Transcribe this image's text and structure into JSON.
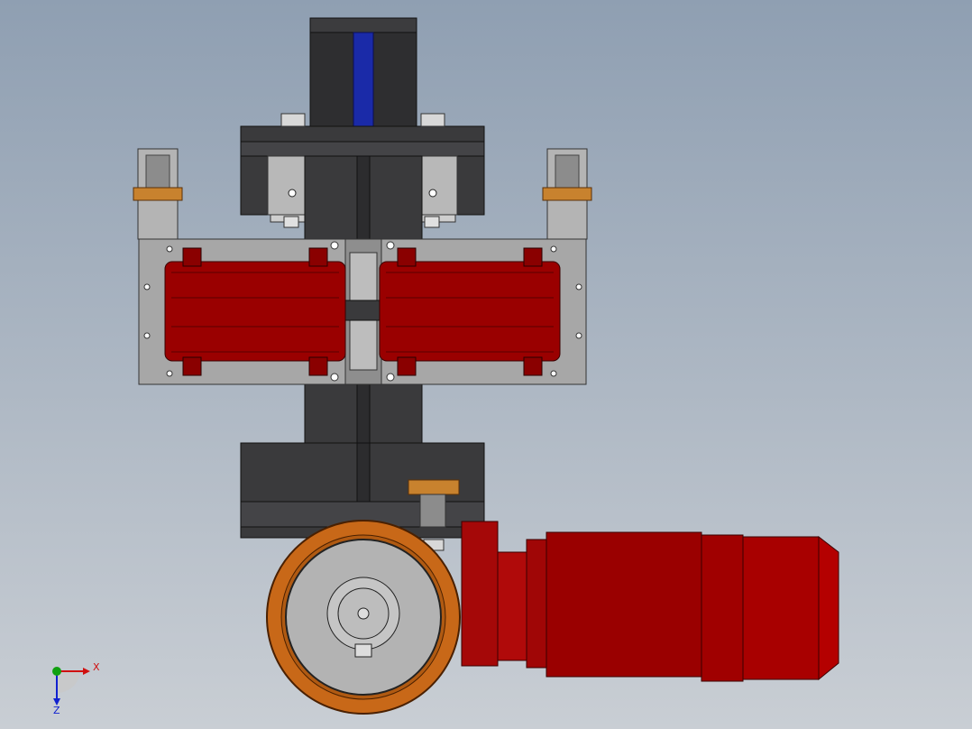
{
  "scene": {
    "background_top": "#8f9fb2",
    "background_bottom": "#c9ced4",
    "colors": {
      "frame_dark": "#3a3a3c",
      "plate_gray": "#a7a7a7",
      "motor_red": "#9a0000",
      "tire_orange": "#c86818",
      "shaft_blue": "#1a2aa8",
      "bushing_tan": "#c8822e"
    }
  },
  "triad": {
    "x_label": "X",
    "z_label": "Z",
    "x_color": "#d01010",
    "y_color": "#10a010",
    "z_color": "#1020d0"
  }
}
